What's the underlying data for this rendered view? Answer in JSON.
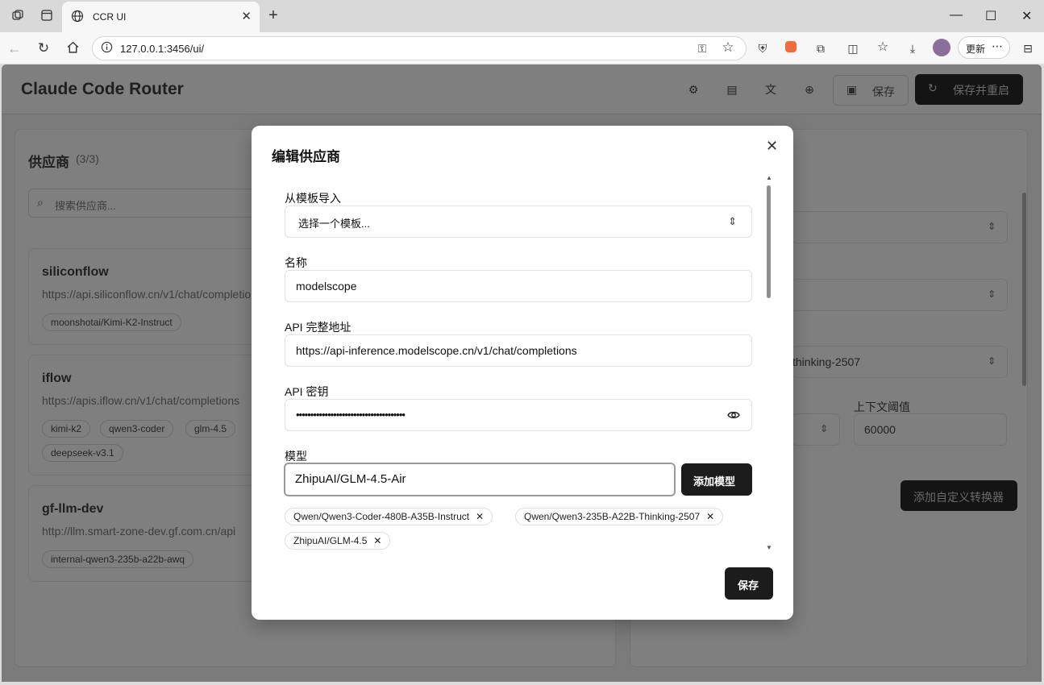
{
  "browser": {
    "tab_title": "CCR UI",
    "url": "127.0.0.1:3456/ui/",
    "update_label": "更新"
  },
  "app": {
    "title": "Claude Code Router",
    "save_label": "保存",
    "save_restart_label": "保存并重启"
  },
  "providers": {
    "title": "供应商",
    "count": "(3/3)",
    "search_placeholder": "搜索供应商...",
    "items": [
      {
        "name": "siliconflow",
        "url": "https://api.siliconflow.cn/v1/chat/completions",
        "models": [
          "moonshotai/Kimi-K2-Instruct"
        ]
      },
      {
        "name": "iflow",
        "url": "https://apis.iflow.cn/v1/chat/completions",
        "models": [
          "kimi-k2",
          "qwen3-coder",
          "glm-4.5",
          "deepseek-v3.1"
        ]
      },
      {
        "name": "gf-llm-dev",
        "url": "http://llm.smart-zone-dev.gf.com.cn/api",
        "models": [
          "internal-qwen3-235b-a22b-awq"
        ]
      }
    ]
  },
  "router_panel": {
    "model_value": "thinking-2507",
    "context_label": "上下文阈值",
    "context_value": "60000",
    "add_transformer_label": "添加自定义转换器"
  },
  "modal": {
    "title": "编辑供应商",
    "template_label": "从模板导入",
    "template_placeholder": "选择一个模板...",
    "name_label": "名称",
    "name_value": "modelscope",
    "api_url_label": "API 完整地址",
    "api_url_value": "https://api-inference.modelscope.cn/v1/chat/completions",
    "api_key_label": "API 密钥",
    "api_key_value": "••••••••••••••••••••••••••••••••••••••",
    "models_label": "模型",
    "model_input_value": "ZhipuAI/GLM-4.5-Air",
    "add_model_label": "添加模型",
    "models": [
      "Qwen/Qwen3-Coder-480B-A35B-Instruct",
      "Qwen/Qwen3-235B-A22B-Thinking-2507",
      "ZhipuAI/GLM-4.5"
    ],
    "save_label": "保存"
  }
}
